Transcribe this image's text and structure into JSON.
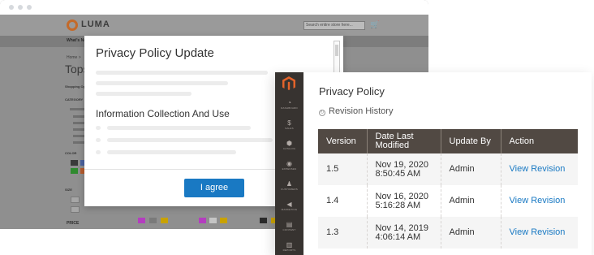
{
  "colors": {
    "modal_button": "#1979c3",
    "admin_sidebar": "#373330",
    "table_header": "#514943",
    "link": "#1979c3",
    "logo_orange": "#e3632a"
  },
  "storefront": {
    "logo_text": "LUMA",
    "search_placeholder": "Search entire store here...",
    "nav_item": "What's New",
    "breadcrumb": "Home  >",
    "page_heading": "Tops",
    "sidebar": {
      "shopping_options": "Shopping Options",
      "category": "CATEGORY",
      "color": "COLOR",
      "size": "SIZE",
      "price": "PRICE"
    }
  },
  "modal": {
    "title": "Privacy Policy Update",
    "section_heading": "Information Collection And Use",
    "agree_label": "I agree"
  },
  "admin": {
    "nav": [
      {
        "icon": "dashboard-icon",
        "glyph": "◔",
        "label": "DASHBOARD"
      },
      {
        "icon": "sales-icon",
        "glyph": "$",
        "label": "SALES"
      },
      {
        "icon": "catalog-icon",
        "glyph": "⬢",
        "label": "CATALOG"
      },
      {
        "icon": "expenses-icon",
        "glyph": "◉",
        "label": "EXPENSES"
      },
      {
        "icon": "customers-icon",
        "glyph": "♟",
        "label": "CUSTOMERS"
      },
      {
        "icon": "marketing-icon",
        "glyph": "◀",
        "label": "MARKETING"
      },
      {
        "icon": "content-icon",
        "glyph": "▤",
        "label": "CONTENT"
      },
      {
        "icon": "reports-icon",
        "glyph": "▥",
        "label": "REPORTS"
      }
    ],
    "title": "Privacy Policy",
    "revision_history": "Revision History",
    "table": {
      "headers": [
        "Version",
        "Date Last Modified",
        "Update By",
        "Action"
      ],
      "rows": [
        {
          "version": "1.5",
          "date": "Nov 19, 2020",
          "time": "8:50:45 AM",
          "by": "Admin",
          "action": "View Revision"
        },
        {
          "version": "1.4",
          "date": "Nov 16, 2020",
          "time": "5:16:28 AM",
          "by": "Admin",
          "action": "View Revision"
        },
        {
          "version": "1.3",
          "date": "Nov 14, 2019",
          "time": "4:06:14 AM",
          "by": "Admin",
          "action": "View Revision"
        }
      ]
    }
  }
}
